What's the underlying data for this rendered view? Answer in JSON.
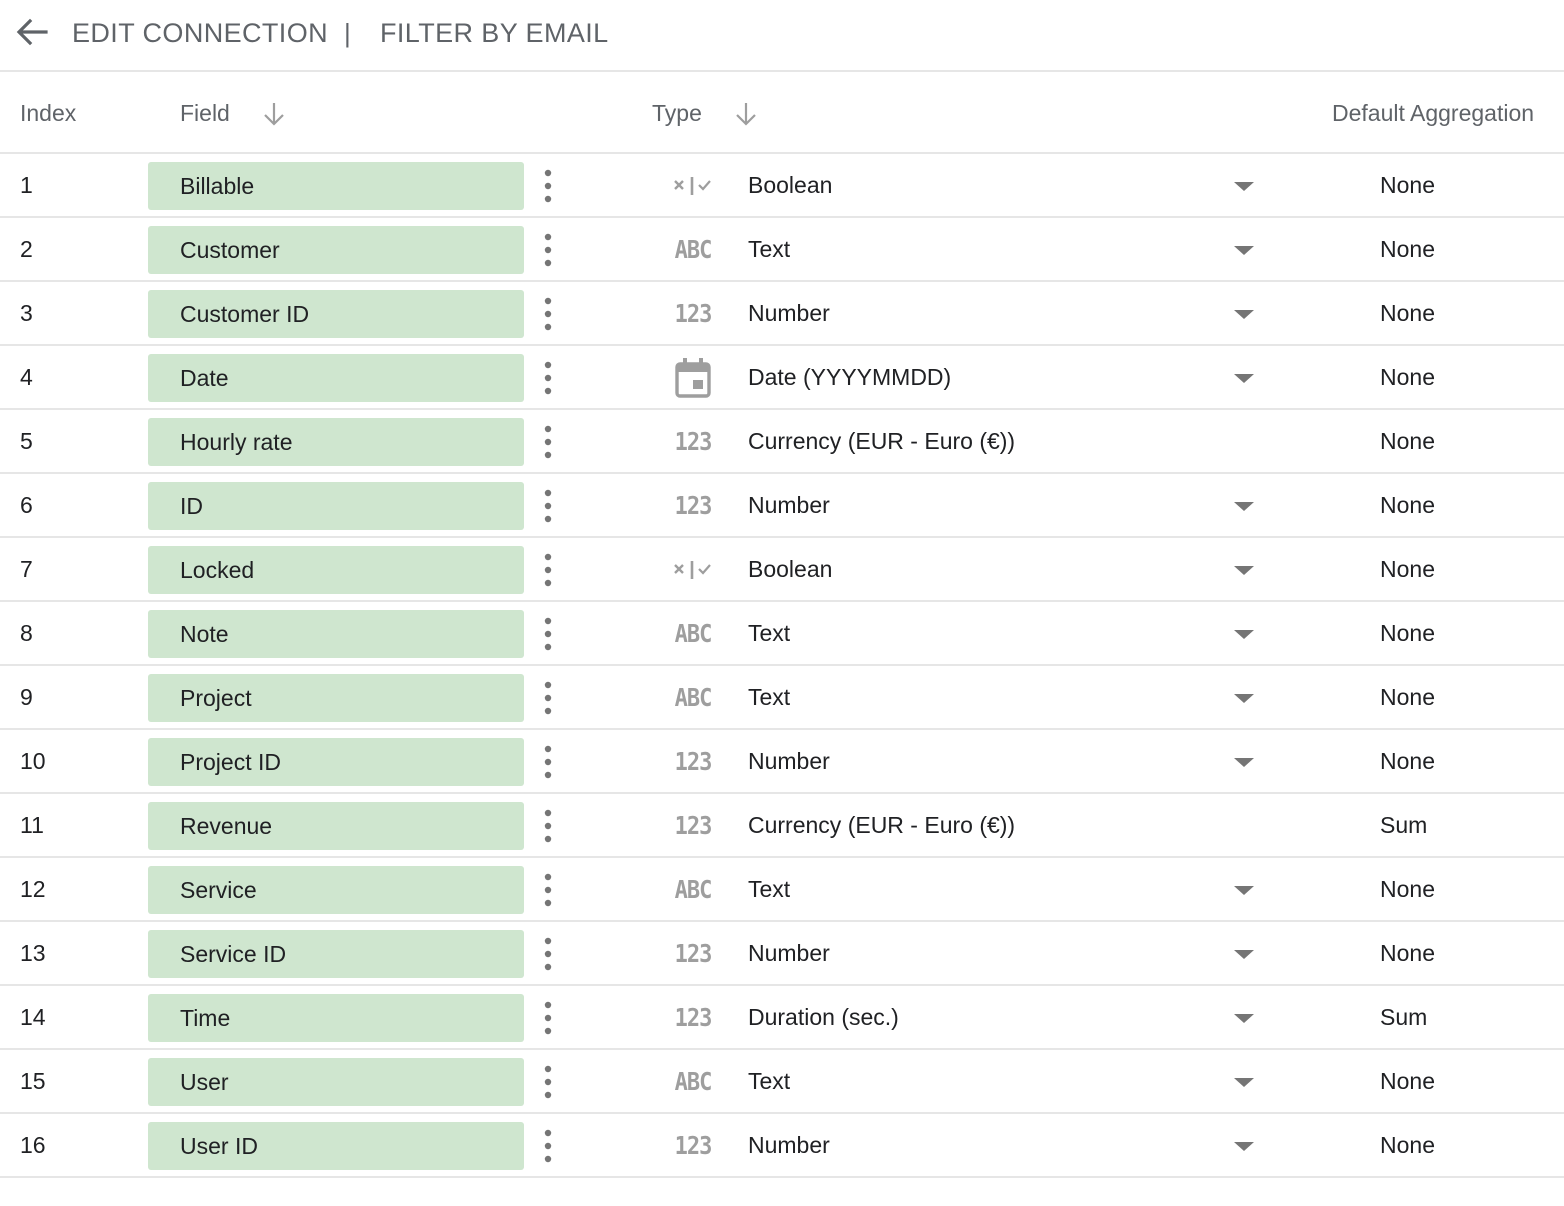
{
  "header": {
    "back_icon": "arrow-left-icon",
    "title": "EDIT CONNECTION",
    "separator": "|",
    "subtitle": "FILTER BY EMAIL"
  },
  "columns": {
    "index": "Index",
    "field": "Field",
    "type": "Type",
    "aggregation": "Default Aggregation"
  },
  "rows": [
    {
      "index": "1",
      "field": "Billable",
      "type_icon": "boolean-icon",
      "type": "Boolean",
      "dropdown": true,
      "aggregation": "None"
    },
    {
      "index": "2",
      "field": "Customer",
      "type_icon": "text-icon",
      "type": "Text",
      "dropdown": true,
      "aggregation": "None"
    },
    {
      "index": "3",
      "field": "Customer ID",
      "type_icon": "number-icon",
      "type": "Number",
      "dropdown": true,
      "aggregation": "None"
    },
    {
      "index": "4",
      "field": "Date",
      "type_icon": "calendar-icon",
      "type": "Date (YYYYMMDD)",
      "dropdown": true,
      "aggregation": "None"
    },
    {
      "index": "5",
      "field": "Hourly rate",
      "type_icon": "number-icon",
      "type": "Currency (EUR - Euro (€))",
      "dropdown": false,
      "aggregation": "None"
    },
    {
      "index": "6",
      "field": "ID",
      "type_icon": "number-icon",
      "type": "Number",
      "dropdown": true,
      "aggregation": "None"
    },
    {
      "index": "7",
      "field": "Locked",
      "type_icon": "boolean-icon",
      "type": "Boolean",
      "dropdown": true,
      "aggregation": "None"
    },
    {
      "index": "8",
      "field": "Note",
      "type_icon": "text-icon",
      "type": "Text",
      "dropdown": true,
      "aggregation": "None"
    },
    {
      "index": "9",
      "field": "Project",
      "type_icon": "text-icon",
      "type": "Text",
      "dropdown": true,
      "aggregation": "None"
    },
    {
      "index": "10",
      "field": "Project ID",
      "type_icon": "number-icon",
      "type": "Number",
      "dropdown": true,
      "aggregation": "None"
    },
    {
      "index": "11",
      "field": "Revenue",
      "type_icon": "number-icon",
      "type": "Currency (EUR - Euro (€))",
      "dropdown": false,
      "aggregation": "Sum"
    },
    {
      "index": "12",
      "field": "Service",
      "type_icon": "text-icon",
      "type": "Text",
      "dropdown": true,
      "aggregation": "None"
    },
    {
      "index": "13",
      "field": "Service ID",
      "type_icon": "number-icon",
      "type": "Number",
      "dropdown": true,
      "aggregation": "None"
    },
    {
      "index": "14",
      "field": "Time",
      "type_icon": "number-icon",
      "type": "Duration (sec.)",
      "dropdown": true,
      "aggregation": "Sum"
    },
    {
      "index": "15",
      "field": "User",
      "type_icon": "text-icon",
      "type": "Text",
      "dropdown": true,
      "aggregation": "None"
    },
    {
      "index": "16",
      "field": "User ID",
      "type_icon": "number-icon",
      "type": "Number",
      "dropdown": true,
      "aggregation": "None"
    }
  ],
  "glyphs": {
    "text": "ABC",
    "number": "123"
  },
  "colors": {
    "chip": "#cfe6cf",
    "icon": "#9e9e9e",
    "muted_text": "#5f6368"
  }
}
